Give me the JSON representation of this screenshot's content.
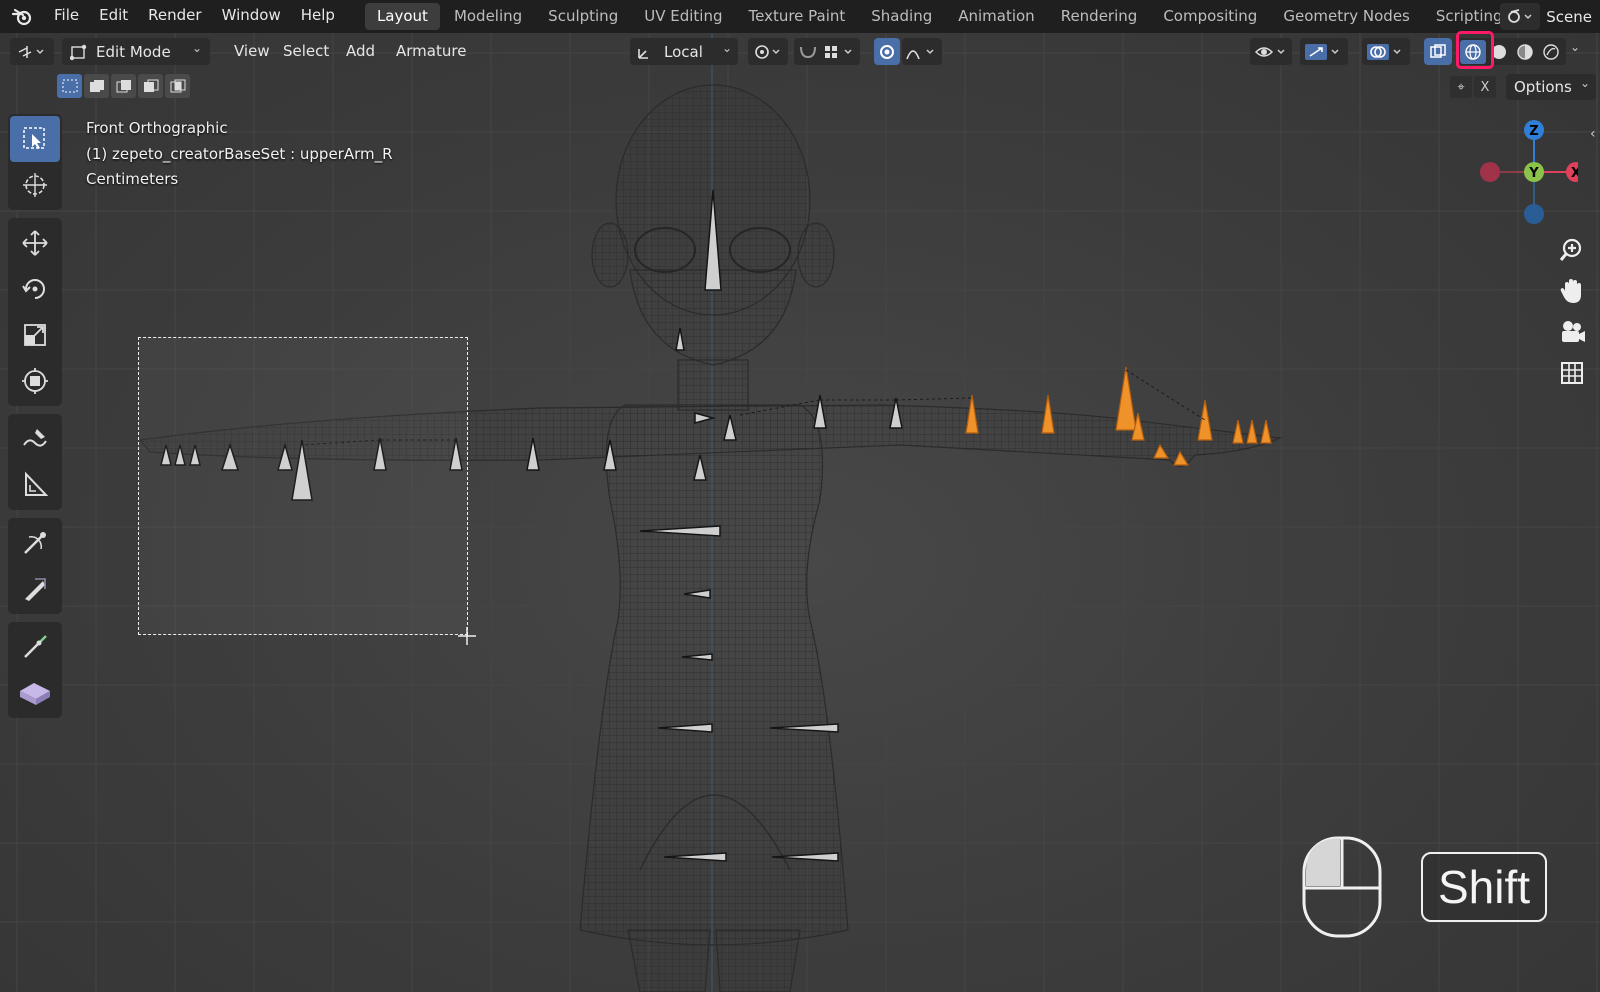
{
  "colors": {
    "accent_blue": "#4a6ea8",
    "highlight": "#ff1966",
    "bone_selected": "#f0922a",
    "axis_x": "#e0415a",
    "axis_y": "#8bc34a",
    "axis_z": "#2f7fd6"
  },
  "top_menu": {
    "items": [
      "File",
      "Edit",
      "Render",
      "Window",
      "Help"
    ]
  },
  "workspaces": {
    "tabs": [
      "Layout",
      "Modeling",
      "Sculpting",
      "UV Editing",
      "Texture Paint",
      "Shading",
      "Animation",
      "Rendering",
      "Compositing",
      "Geometry Nodes",
      "Scripting"
    ],
    "active": "Layout"
  },
  "scene": {
    "label": "Scene"
  },
  "header": {
    "mode": "Edit Mode",
    "menus": [
      "View",
      "Select",
      "Add",
      "Armature"
    ],
    "transform_orientation": "Local",
    "options_label": "Options",
    "xray_label": "X"
  },
  "overlay": {
    "view_name": "Front Orthographic",
    "object_info": "(1) zepeto_creatorBaseSet : upperArm_R",
    "units": "Centimeters"
  },
  "gizmo": {
    "z_label": "Z",
    "y_label": "Y",
    "x_label": "X"
  },
  "tools": [
    "select-box-tool",
    "cursor-tool",
    "move-tool",
    "rotate-tool",
    "scale-tool",
    "transform-tool",
    "annotate-tool",
    "measure-tool",
    "roll-tool",
    "bone-size-tool",
    "extrude-tool",
    "bone-envelope-tool"
  ],
  "input_overlay": {
    "key_label": "Shift",
    "mouse_button": "left"
  }
}
